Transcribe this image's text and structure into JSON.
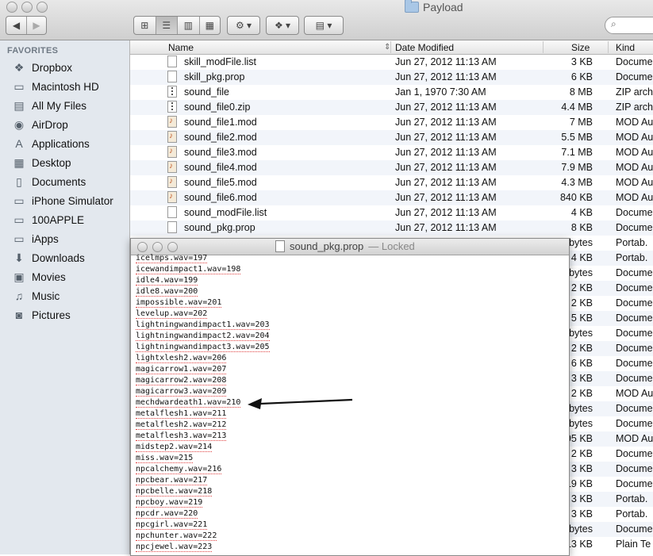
{
  "window": {
    "title": "Payload"
  },
  "sidebar": {
    "heading": "FAVORITES",
    "items": [
      {
        "label": "Dropbox",
        "icon": "dropbox-icon"
      },
      {
        "label": "Macintosh HD",
        "icon": "hard-drive-icon"
      },
      {
        "label": "All My Files",
        "icon": "all-files-icon"
      },
      {
        "label": "AirDrop",
        "icon": "airdrop-icon"
      },
      {
        "label": "Applications",
        "icon": "applications-icon"
      },
      {
        "label": "Desktop",
        "icon": "desktop-icon"
      },
      {
        "label": "Documents",
        "icon": "documents-icon"
      },
      {
        "label": "iPhone Simulator",
        "icon": "folder-icon"
      },
      {
        "label": "100APPLE",
        "icon": "folder-icon"
      },
      {
        "label": "iApps",
        "icon": "folder-icon"
      },
      {
        "label": "Downloads",
        "icon": "downloads-icon"
      },
      {
        "label": "Movies",
        "icon": "movies-icon"
      },
      {
        "label": "Music",
        "icon": "music-icon"
      },
      {
        "label": "Pictures",
        "icon": "pictures-icon"
      }
    ]
  },
  "columns": {
    "name": "Name",
    "date": "Date Modified",
    "size": "Size",
    "kind": "Kind"
  },
  "files": [
    {
      "name": "skill_modFile.list",
      "date": "Jun 27, 2012 11:13 AM",
      "size": "3 KB",
      "kind": "Docume",
      "icon": "doc"
    },
    {
      "name": "skill_pkg.prop",
      "date": "Jun 27, 2012 11:13 AM",
      "size": "6 KB",
      "kind": "Docume",
      "icon": "doc"
    },
    {
      "name": "sound_file",
      "date": "Jan 1, 1970 7:30 AM",
      "size": "8 MB",
      "kind": "ZIP arch",
      "icon": "zip"
    },
    {
      "name": "sound_file0.zip",
      "date": "Jun 27, 2012 11:13 AM",
      "size": "4.4 MB",
      "kind": "ZIP arch",
      "icon": "zip"
    },
    {
      "name": "sound_file1.mod",
      "date": "Jun 27, 2012 11:13 AM",
      "size": "7 MB",
      "kind": "MOD Au",
      "icon": "mod"
    },
    {
      "name": "sound_file2.mod",
      "date": "Jun 27, 2012 11:13 AM",
      "size": "5.5 MB",
      "kind": "MOD Au",
      "icon": "mod"
    },
    {
      "name": "sound_file3.mod",
      "date": "Jun 27, 2012 11:13 AM",
      "size": "7.1 MB",
      "kind": "MOD Au",
      "icon": "mod"
    },
    {
      "name": "sound_file4.mod",
      "date": "Jun 27, 2012 11:13 AM",
      "size": "7.9 MB",
      "kind": "MOD Au",
      "icon": "mod"
    },
    {
      "name": "sound_file5.mod",
      "date": "Jun 27, 2012 11:13 AM",
      "size": "4.3 MB",
      "kind": "MOD Au",
      "icon": "mod"
    },
    {
      "name": "sound_file6.mod",
      "date": "Jun 27, 2012 11:13 AM",
      "size": "840 KB",
      "kind": "MOD Au",
      "icon": "mod"
    },
    {
      "name": "sound_modFile.list",
      "date": "Jun 27, 2012 11:13 AM",
      "size": "4 KB",
      "kind": "Docume",
      "icon": "doc"
    },
    {
      "name": "sound_pkg.prop",
      "date": "Jun 27, 2012 11:13 AM",
      "size": "8 KB",
      "kind": "Docume",
      "icon": "doc"
    },
    {
      "name": "",
      "date": "",
      "size": "bytes",
      "kind": "Portab.",
      "icon": ""
    },
    {
      "name": "",
      "date": "",
      "size": "4 KB",
      "kind": "Portab.",
      "icon": ""
    },
    {
      "name": "",
      "date": "",
      "size": "bytes",
      "kind": "Docume",
      "icon": ""
    },
    {
      "name": "",
      "date": "",
      "size": "2 KB",
      "kind": "Docume",
      "icon": ""
    },
    {
      "name": "",
      "date": "",
      "size": "2 KB",
      "kind": "Docume",
      "icon": ""
    },
    {
      "name": "",
      "date": "",
      "size": "5 KB",
      "kind": "Docume",
      "icon": ""
    },
    {
      "name": "",
      "date": "",
      "size": "bytes",
      "kind": "Docume",
      "icon": ""
    },
    {
      "name": "",
      "date": "",
      "size": "2 KB",
      "kind": "Docume",
      "icon": ""
    },
    {
      "name": "",
      "date": "",
      "size": "6 KB",
      "kind": "Docume",
      "icon": ""
    },
    {
      "name": "",
      "date": "",
      "size": "3 KB",
      "kind": "Docume",
      "icon": ""
    },
    {
      "name": "",
      "date": "",
      "size": "2 KB",
      "kind": "MOD Au",
      "icon": ""
    },
    {
      "name": "",
      "date": "",
      "size": "bytes",
      "kind": "Docume",
      "icon": ""
    },
    {
      "name": "",
      "date": "",
      "size": "bytes",
      "kind": "Docume",
      "icon": ""
    },
    {
      "name": "",
      "date": "",
      "size": "95 KB",
      "kind": "MOD Au",
      "icon": ""
    },
    {
      "name": "",
      "date": "",
      "size": "2 KB",
      "kind": "Docume",
      "icon": ""
    },
    {
      "name": "",
      "date": "",
      "size": "3 KB",
      "kind": "Docume",
      "icon": ""
    },
    {
      "name": "",
      "date": "",
      "size": "19 KB",
      "kind": "Docume",
      "icon": ""
    },
    {
      "name": "",
      "date": "",
      "size": "3 KB",
      "kind": "Portab.",
      "icon": ""
    },
    {
      "name": "",
      "date": "",
      "size": "3 KB",
      "kind": "Portab.",
      "icon": ""
    },
    {
      "name": "",
      "date": "",
      "size": "bytes",
      "kind": "Docume",
      "icon": ""
    },
    {
      "name": "",
      "date": "",
      "size": "13 KB",
      "kind": "Plain Te",
      "icon": ""
    }
  ],
  "text_window": {
    "title": "sound_pkg.prop",
    "status": "— Locked",
    "lines": [
      "icelmps.wav=197",
      "icewandimpact1.wav=198",
      "idle4.wav=199",
      "idle8.wav=200",
      "impossible.wav=201",
      "levelup.wav=202",
      "lightningwandimpact1.wav=203",
      "lightningwandimpact2.wav=204",
      "lightningwandimpact3.wav=205",
      "lightxlesh2.wav=206",
      "magicarrow1.wav=207",
      "magicarrow2.wav=208",
      "magicarrow3.wav=209",
      "mechdwardeath1.wav=210",
      "metalflesh1.wav=211",
      "metalflesh2.wav=212",
      "metalflesh3.wav=213",
      "midstep2.wav=214",
      "miss.wav=215",
      "npcalchemy.wav=216",
      "npcbear.wav=217",
      "npcbelle.wav=218",
      "npcboy.wav=219",
      "npcdr.wav=220",
      "npcgirl.wav=221",
      "npchunter.wav=222",
      "npcjewel.wav=223"
    ]
  },
  "annotation": {
    "arrow_target_line": "mechdwardeath1.wav=210",
    "arrow_color": "#111111"
  }
}
